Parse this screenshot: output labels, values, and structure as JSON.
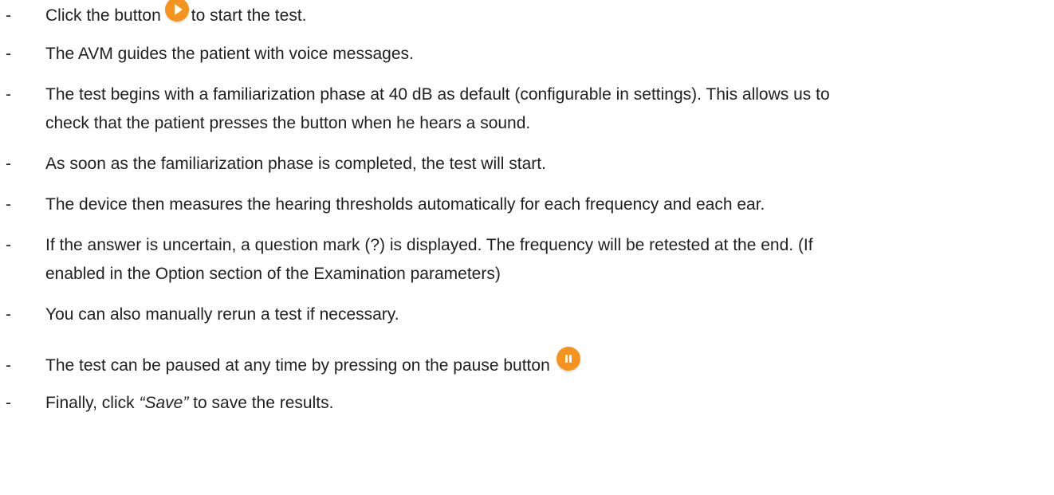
{
  "instructions": [
    {
      "before": "Click the button",
      "icon": "play-icon",
      "after": "to start the test."
    },
    {
      "text": "The AVM guides the patient with voice messages."
    },
    {
      "line1": "The test begins with a familiarization phase at 40 dB as default (configurable in settings). This allows us to",
      "line2": "check that the patient presses the button when he hears a sound."
    },
    {
      "text": "As soon as the familiarization phase is completed, the test will start."
    },
    {
      "text": "The device then measures the hearing thresholds automatically for each frequency and each ear."
    },
    {
      "line1": "If the answer is uncertain, a question mark (?) is displayed. The frequency will be retested at the end. (If",
      "line2": "enabled in the Option section of the Examination parameters)"
    },
    {
      "text": "You can also manually rerun a test if necessary."
    },
    {
      "text": "The test can be paused at any time by pressing on the pause button",
      "icon": "pause-icon"
    },
    {
      "before": "Finally, click ",
      "emphasis": "“Save”",
      "after": " to save the results."
    }
  ],
  "bullet_marker": "-",
  "accent_color": "#f6931f"
}
